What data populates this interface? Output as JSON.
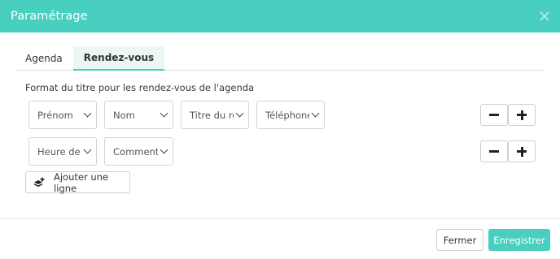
{
  "dialog": {
    "title": "Paramétrage",
    "accent_color": "#48cfc0"
  },
  "tabs": [
    {
      "label": "Agenda",
      "active": false
    },
    {
      "label": "Rendez-vous",
      "active": true
    }
  ],
  "section": {
    "label": "Format du titre pour les rendez-vous de l'agenda"
  },
  "rows": [
    {
      "fields": [
        "Prénom",
        "Nom",
        "Titre du re",
        "Téléphone"
      ]
    },
    {
      "fields": [
        "Heure de c",
        "Commenta"
      ]
    }
  ],
  "add_line": {
    "label": "Ajouter une ligne",
    "icon": "layers-plus-icon"
  },
  "footer": {
    "close_label": "Fermer",
    "save_label": "Enregistrer"
  }
}
